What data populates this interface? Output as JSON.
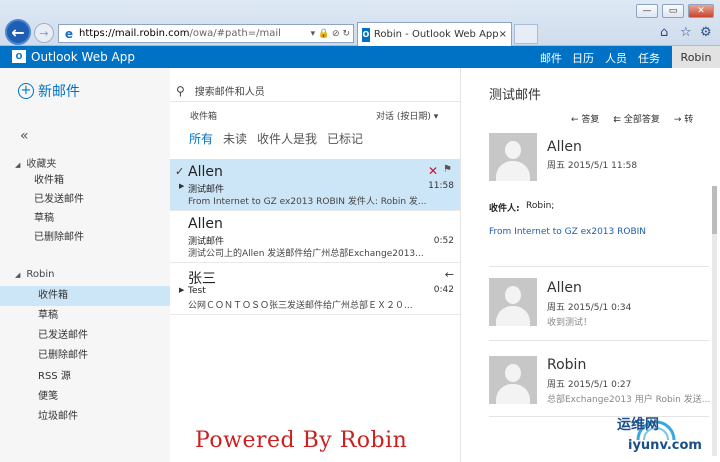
{
  "browser": {
    "url_prefix": "https://",
    "url_host": "mail.robin.com",
    "url_rest": "/owa/#path=/mail",
    "address_tools": "▾ 🔒 ⊘ ↻",
    "tab_title": "Robin - Outlook Web App",
    "tab_close": "×"
  },
  "owa": {
    "app_title": "Outlook Web App",
    "logo_text": "O",
    "nav": [
      "邮件",
      "日历",
      "人员",
      "任务"
    ],
    "user": "Robin"
  },
  "left": {
    "new_mail": "新邮件",
    "collapse": "«",
    "favorites_header": "收藏夹",
    "favorites": [
      "收件箱",
      "已发送邮件",
      "草稿",
      "已删除邮件"
    ],
    "account_header": "Robin",
    "folders": [
      "收件箱",
      "草稿",
      "已发送邮件",
      "已删除邮件",
      "RSS 源",
      "便笺",
      "垃圾邮件"
    ]
  },
  "mid": {
    "search_placeholder": "搜索邮件和人员",
    "folder_label": "收件箱",
    "sort_label": "对话 (按日期) ▾",
    "filters": [
      "所有",
      "未读",
      "收件人是我",
      "已标记"
    ],
    "messages": [
      {
        "sender": "Allen",
        "subject": "测试邮件",
        "preview": "From Internet to GZ ex2013 ROBIN 发件人: Robin 发...",
        "time": "11:58"
      },
      {
        "sender": "Allen",
        "subject": "测试邮件",
        "preview": "测试公司上的Allen 发送邮件给广州总部Exchange2013...",
        "time": "0:52"
      },
      {
        "sender": "张三",
        "subject": "Test",
        "preview": "公网ＣＯＮＴＯＳＯ张三发送邮件给广州总部ＥＸ２０...",
        "time": "0:42"
      }
    ]
  },
  "reading": {
    "title": "测试邮件",
    "actions": [
      "答复",
      "全部答复",
      "转"
    ],
    "items": [
      {
        "sender": "Allen",
        "date": "周五 2015/5/1 11:58"
      },
      {
        "sender": "Allen",
        "date": "周五 2015/5/1 0:34",
        "snippet": "收到测试！"
      },
      {
        "sender": "Robin",
        "date": "周五 2015/5/1 0:27",
        "snippet": "总部Exchange2013 用户 Robin 发送..."
      }
    ],
    "to_label": "收件人:",
    "to_value": "Robin;",
    "body": "From Internet to GZ ex2013 ROBIN"
  },
  "overlay": {
    "powered": "Powered By Robin",
    "watermark_cn": "运维网",
    "watermark_en": "iyunv.com"
  },
  "colors": {
    "accent": "#0072c6",
    "selected": "#cde6f7"
  }
}
